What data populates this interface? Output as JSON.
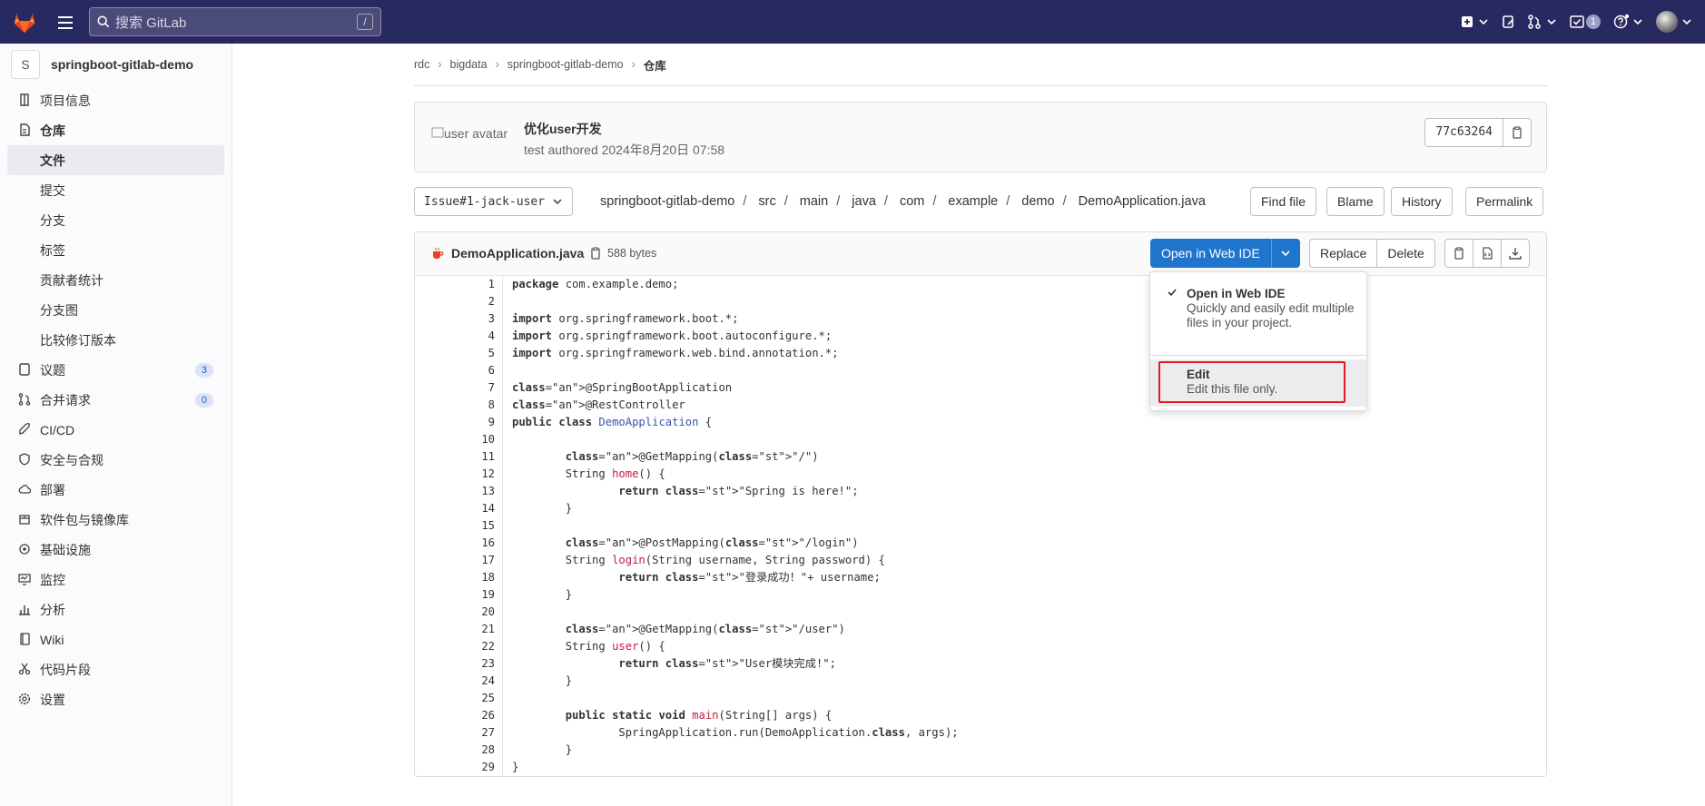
{
  "topbar": {
    "search_placeholder": "搜索 GitLab",
    "search_shortcut": "/",
    "todo_count": "1"
  },
  "sidebar": {
    "project_initial": "S",
    "project_name": "springboot-gitlab-demo",
    "items": [
      {
        "label": "项目信息",
        "icon": "info-icon"
      },
      {
        "label": "仓库",
        "icon": "repo-icon"
      },
      {
        "label": "文件"
      },
      {
        "label": "提交"
      },
      {
        "label": "分支"
      },
      {
        "label": "标签"
      },
      {
        "label": "贡献者统计"
      },
      {
        "label": "分支图"
      },
      {
        "label": "比较修订版本"
      },
      {
        "label": "议题",
        "icon": "issues-icon",
        "count": "3"
      },
      {
        "label": "合并请求",
        "icon": "merge-request-icon",
        "count": "0"
      },
      {
        "label": "CI/CD",
        "icon": "rocket-icon"
      },
      {
        "label": "安全与合规",
        "icon": "shield-icon"
      },
      {
        "label": "部署",
        "icon": "cloud-icon"
      },
      {
        "label": "软件包与镜像库",
        "icon": "package-icon"
      },
      {
        "label": "基础设施",
        "icon": "infrastructure-icon"
      },
      {
        "label": "监控",
        "icon": "monitor-icon"
      },
      {
        "label": "分析",
        "icon": "chart-icon"
      },
      {
        "label": "Wiki",
        "icon": "book-icon"
      },
      {
        "label": "代码片段",
        "icon": "snippet-icon"
      },
      {
        "label": "设置",
        "icon": "settings-icon"
      }
    ]
  },
  "breadcrumb": [
    "rdc",
    "bigdata",
    "springboot-gitlab-demo",
    "仓库"
  ],
  "commit": {
    "avatar_alt": "user avatar",
    "message": "优化user开发",
    "meta": "test authored 2024年8月20日 07:58",
    "sha": "77c63264"
  },
  "branch": "Issue#1-jack-user",
  "path": [
    "springboot-gitlab-demo",
    "src",
    "main",
    "java",
    "com",
    "example",
    "demo",
    "DemoApplication.java"
  ],
  "path_buttons": {
    "find": "Find file",
    "blame": "Blame",
    "history": "History",
    "permalink": "Permalink"
  },
  "file": {
    "name": "DemoApplication.java",
    "size": "588 bytes",
    "open_ide": "Open in Web IDE",
    "replace": "Replace",
    "delete": "Delete"
  },
  "dropdown": {
    "opt1_title": "Open in Web IDE",
    "opt1_desc": "Quickly and easily edit multiple files in your project.",
    "opt2_title": "Edit",
    "opt2_desc": "Edit this file only."
  },
  "code_lines": [
    "package com.example.demo;",
    "",
    "import org.springframework.boot.*;",
    "import org.springframework.boot.autoconfigure.*;",
    "import org.springframework.web.bind.annotation.*;",
    "",
    "@SpringBootApplication",
    "@RestController",
    "public class DemoApplication {",
    "",
    "        @GetMapping(\"/\")",
    "        String home() {",
    "                return \"Spring is here!\";",
    "        }",
    "",
    "        @PostMapping(\"/login\")",
    "        String login(String username, String password) {",
    "                return \"登录成功！\"+ username;",
    "        }",
    "",
    "        @GetMapping(\"/user\")",
    "        String user() {",
    "                return \"User模块完成!\";",
    "        }",
    "",
    "        public static void main(String[] args) {",
    "                SpringApplication.run(DemoApplication.class, args);",
    "        }",
    "}"
  ]
}
